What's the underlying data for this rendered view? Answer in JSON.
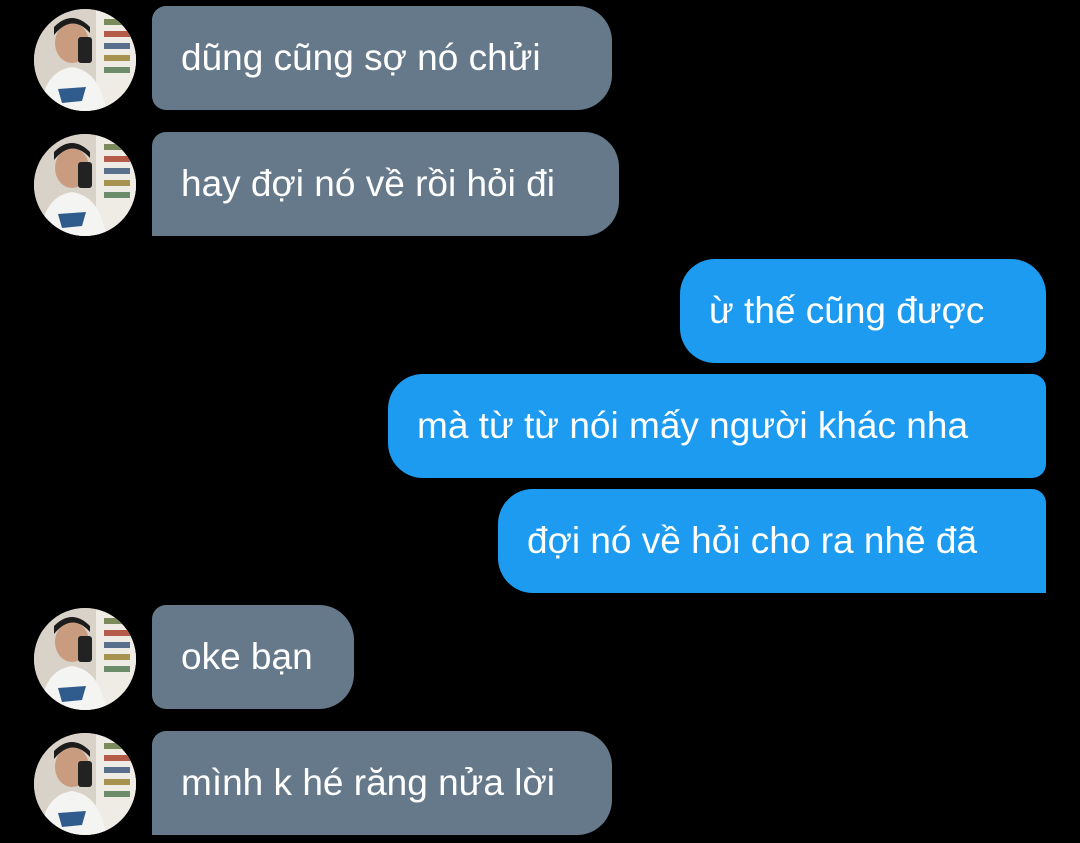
{
  "colors": {
    "background": "#000000",
    "incoming_bubble": "#66798a",
    "outgoing_bubble": "#1d9bf0",
    "text": "#ffffff"
  },
  "messages": [
    {
      "sender": "other",
      "text": "dũng cũng sợ nó chửi",
      "avatar_icon": "user-avatar-icon"
    },
    {
      "sender": "other",
      "text": "hay đợi nó về rồi hỏi đi",
      "avatar_icon": "user-avatar-icon"
    },
    {
      "sender": "me",
      "text": "ừ thế cũng được"
    },
    {
      "sender": "me",
      "text": "mà từ từ nói mấy người khác nha"
    },
    {
      "sender": "me",
      "text": "đợi nó về hỏi cho ra nhẽ đã"
    },
    {
      "sender": "other",
      "text": "oke bạn",
      "avatar_icon": "user-avatar-icon"
    },
    {
      "sender": "other",
      "text": "mình k hé răng nửa lời",
      "avatar_icon": "user-avatar-icon"
    }
  ]
}
